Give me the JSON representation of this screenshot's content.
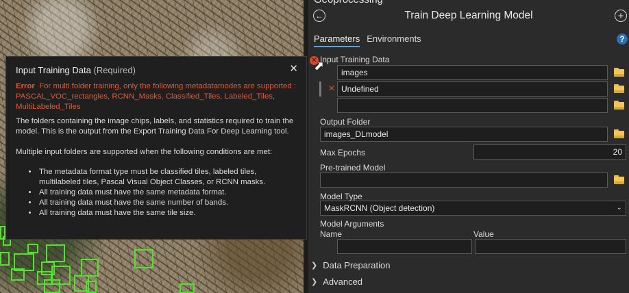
{
  "panel": {
    "header_cut": "Geoprocessing",
    "tool_title": "Train Deep Learning Model",
    "tabs": [
      {
        "label": "Parameters",
        "active": true
      },
      {
        "label": "Environments",
        "active": false
      }
    ],
    "help_icon": "?",
    "icons": {
      "back": "back-arrow-icon",
      "add": "plus-icon",
      "help": "help-icon",
      "folder": "folder-icon",
      "error": "error-icon"
    }
  },
  "params": {
    "input_training_data": {
      "label": "Input Training Data",
      "rows": [
        "images",
        "Undefined",
        ""
      ]
    },
    "output_folder": {
      "label": "Output Folder",
      "value": "images_DLmodel"
    },
    "max_epochs": {
      "label": "Max Epochs",
      "value": "20"
    },
    "pretrained": {
      "label": "Pre-trained Model",
      "value": ""
    },
    "model_type": {
      "label": "Model Type",
      "value": "MaskRCNN (Object detection)"
    },
    "model_arguments": {
      "label": "Model Arguments",
      "col_name": "Name",
      "col_value": "Value",
      "name": "",
      "value": ""
    }
  },
  "sections": [
    {
      "label": "Data Preparation"
    },
    {
      "label": "Advanced"
    }
  ],
  "tooltip": {
    "title": "Input Training Data",
    "required": "(Required)",
    "close": "✕",
    "error_label": "Error",
    "error_text": "For multi folder training, only the following metadatamodes are supported : PASCAL_VOC_rectangles, RCNN_Masks, Classified_Tiles, Labeled_Tiles, MultiLabeled_Tiles",
    "description": "The folders containing the image chips, labels, and statistics required to train the model. This is the output from the Export Training Data For Deep Learning tool.",
    "conditions_intro": "Multiple input folders are supported when the following conditions are met:",
    "conditions": [
      "The metadata format type must be classified tiles, labeled tiles, multilabeled tiles, Pascal Visual Object Classes, or RCNN masks.",
      "All training data must have the same metadata format.",
      "All training data must have the same number of bands.",
      "All training data must have the same tile size."
    ]
  },
  "colors": {
    "accent": "#59a2e0",
    "error": "#e15a37",
    "bbox": "#4ee52b"
  }
}
